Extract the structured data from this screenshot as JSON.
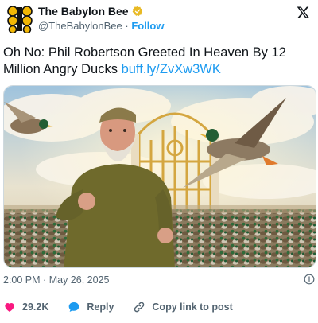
{
  "author": {
    "name": "The Babylon Bee",
    "handle": "@TheBabylonBee",
    "separator": "·",
    "follow_label": "Follow"
  },
  "tweet": {
    "text": "Oh No: Phil Robertson Greeted In Heaven By 12 Million Angry Ducks ",
    "link": "buff.ly/ZvXw3WK"
  },
  "meta": {
    "time": "2:00 PM",
    "separator": "·",
    "date": "May 26, 2025"
  },
  "actions": {
    "like_count": "29.2K",
    "reply_label": "Reply",
    "copy_label": "Copy link to post"
  },
  "icons": {
    "verified": "verified-badge-icon",
    "platform": "x-logo-icon",
    "info": "info-icon",
    "like": "heart-icon",
    "reply": "reply-bubble-icon",
    "copy": "link-icon"
  },
  "colors": {
    "accent": "#1d9bf0",
    "like": "#f91880",
    "verified": "#e8b923",
    "brand": "#f2b705",
    "secondary_text": "#536471"
  }
}
